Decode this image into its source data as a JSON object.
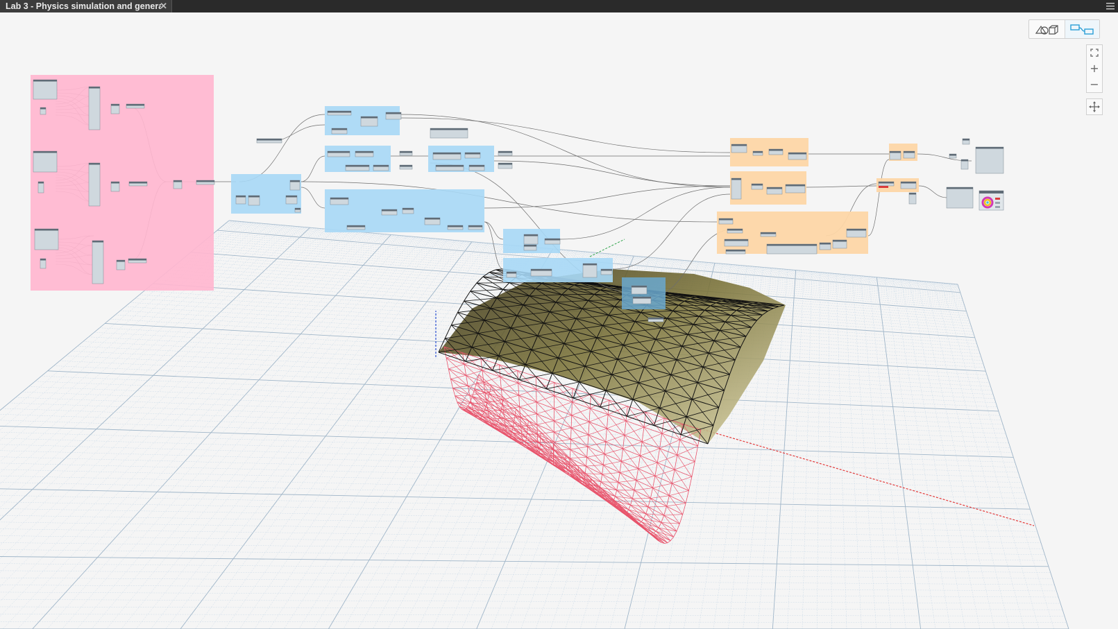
{
  "tab": {
    "title": "Lab 3 - Physics simulation and generati",
    "close_glyph": "✕"
  },
  "toolbar": {
    "view_toggle": {
      "geometry_view_icon": "geometry-view-icon",
      "graph_view_icon": "graph-view-icon",
      "active": "graph"
    }
  },
  "navigation": {
    "fit_icon": "fit-view-icon",
    "zoom_in_glyph": "+",
    "zoom_out_glyph": "−",
    "pan_icon": "pan-icon"
  },
  "groups": [
    {
      "name": "input-group",
      "color": "#ffb6cf"
    },
    {
      "name": "processing-group",
      "color": "#a7d8f6"
    },
    {
      "name": "output-group",
      "color": "#fdd6a6"
    }
  ],
  "colors": {
    "background": "#f5f5f5",
    "grid_minor": "#c7d8e6",
    "grid_major": "#9fb5c8",
    "x_axis": "#e33a3a",
    "y_axis": "#2fa34a",
    "z_axis": "#2b4fd1",
    "deformed_mesh": "#e8536b",
    "shell": "#8a8a4a",
    "wire": "#111111",
    "toggle_accent": "#2a9fd6"
  }
}
